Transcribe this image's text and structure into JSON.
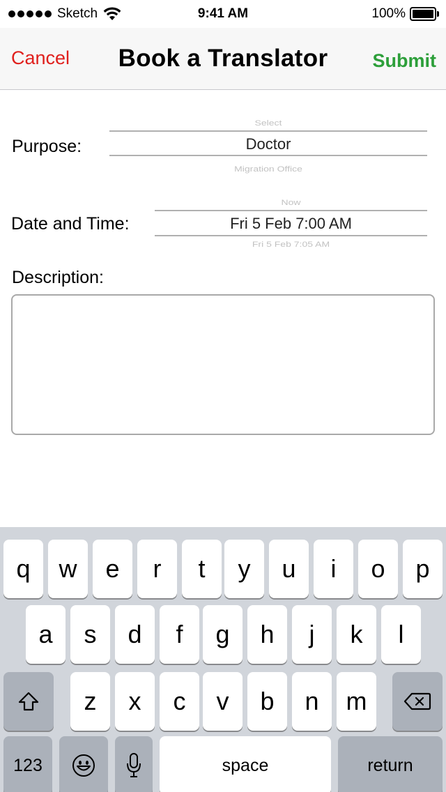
{
  "status_bar": {
    "carrier": "Sketch",
    "time": "9:41 AM",
    "battery": "100%"
  },
  "nav": {
    "cancel": "Cancel",
    "title": "Book a Translator",
    "submit": "Submit"
  },
  "form": {
    "purpose_label": "Purpose:",
    "purpose_picker": {
      "above": "Select",
      "selected": "Doctor",
      "below": "Migration Office"
    },
    "date_label": "Date and Time:",
    "date_picker": {
      "above": "Now",
      "selected": "Fri 5 Feb 7:00 AM",
      "below": "Fri 5 Feb 7:05 AM"
    },
    "description_label": "Description:",
    "description_value": ""
  },
  "keyboard": {
    "row1": [
      "q",
      "w",
      "e",
      "r",
      "t",
      "y",
      "u",
      "i",
      "o",
      "p"
    ],
    "row2": [
      "a",
      "s",
      "d",
      "f",
      "g",
      "h",
      "j",
      "k",
      "l"
    ],
    "row3": [
      "z",
      "x",
      "c",
      "v",
      "b",
      "n",
      "m"
    ],
    "numbers": "123",
    "space": "space",
    "return": "return"
  },
  "colors": {
    "cancel": "#e0201d",
    "submit": "#2d9f3a",
    "keyboard_bg": "#d1d5db"
  },
  "icons": {
    "signal": "signal-dots-icon",
    "wifi": "wifi-icon",
    "battery": "battery-icon",
    "shift": "shift-icon",
    "delete": "delete-icon",
    "emoji": "emoji-icon",
    "mic": "microphone-icon"
  }
}
